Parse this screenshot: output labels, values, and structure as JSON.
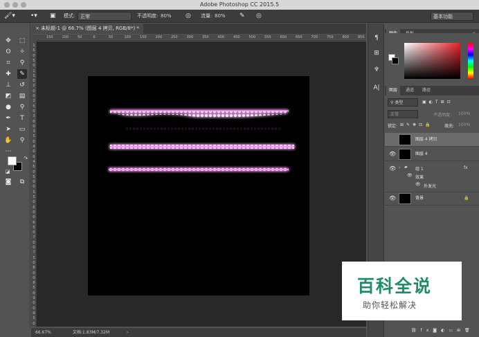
{
  "window": {
    "title": "Adobe Photoshop CC 2015.5"
  },
  "options_bar": {
    "mode_label": "模式:",
    "mode_value": "正常",
    "opacity_label": "不透明度:",
    "opacity_value": "80%",
    "flow_label": "流量:",
    "flow_value": "80%",
    "workspace": "基本功能"
  },
  "document": {
    "tab_label": "未标题-1 @ 66.7% (图层 4 拷贝, RGB/8*) *",
    "ruler_ticks": [
      "150",
      "100",
      "50",
      "0",
      "50",
      "100",
      "150",
      "200",
      "250",
      "300",
      "350",
      "400",
      "450",
      "500",
      "550",
      "600",
      "650",
      "700",
      "750",
      "800",
      "850",
      "900",
      "950"
    ],
    "vruler_ticks": [
      "1",
      "5",
      "0",
      "5",
      "0",
      "1",
      "5",
      "0",
      "2",
      "0",
      "0",
      "2",
      "5",
      "0",
      "3",
      "0",
      "0",
      "3",
      "5",
      "0",
      "4",
      "0",
      "0",
      "4",
      "5",
      "0",
      "5",
      "0",
      "0",
      "5",
      "5",
      "0",
      "6",
      "0",
      "0",
      "6",
      "5",
      "0",
      "7",
      "0",
      "0",
      "7",
      "5",
      "0",
      "8",
      "0",
      "0",
      "8",
      "5",
      "0",
      "9",
      "0",
      "0",
      "9",
      "5",
      "0"
    ]
  },
  "status": {
    "zoom": "66.67%",
    "doc_size": "文档:1.83M/7.32M"
  },
  "color_panel": {
    "tabs": [
      "颜色",
      "色板"
    ]
  },
  "layers_panel": {
    "tabs": [
      "图层",
      "通道",
      "路径"
    ],
    "filter_kind": "类型",
    "blend_mode": "正常",
    "opacity_label": "不透明度:",
    "opacity_value": "100%",
    "lock_label": "锁定:",
    "fill_label": "填充:",
    "fill_value": "100%",
    "layers": [
      {
        "name": "图层 4 拷贝"
      },
      {
        "name": "图层 4"
      },
      {
        "name": "组 1"
      },
      {
        "name": "背景"
      }
    ],
    "effects_label": "效果",
    "effect_name": "外发光",
    "fx": "fx"
  },
  "watermark": {
    "title": "百科全说",
    "subtitle": "助你轻松解决"
  },
  "colors": {
    "glow": "#ff7dff",
    "accent_green": "#1f8c62"
  }
}
